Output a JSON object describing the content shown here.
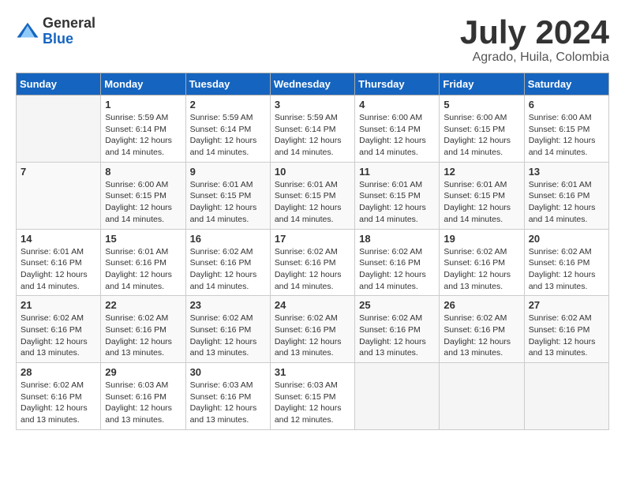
{
  "logo": {
    "general": "General",
    "blue": "Blue"
  },
  "title": "July 2024",
  "location": "Agrado, Huila, Colombia",
  "days_of_week": [
    "Sunday",
    "Monday",
    "Tuesday",
    "Wednesday",
    "Thursday",
    "Friday",
    "Saturday"
  ],
  "weeks": [
    [
      {
        "day": "",
        "info": ""
      },
      {
        "day": "1",
        "info": "Sunrise: 5:59 AM\nSunset: 6:14 PM\nDaylight: 12 hours\nand 14 minutes."
      },
      {
        "day": "2",
        "info": "Sunrise: 5:59 AM\nSunset: 6:14 PM\nDaylight: 12 hours\nand 14 minutes."
      },
      {
        "day": "3",
        "info": "Sunrise: 5:59 AM\nSunset: 6:14 PM\nDaylight: 12 hours\nand 14 minutes."
      },
      {
        "day": "4",
        "info": "Sunrise: 6:00 AM\nSunset: 6:14 PM\nDaylight: 12 hours\nand 14 minutes."
      },
      {
        "day": "5",
        "info": "Sunrise: 6:00 AM\nSunset: 6:15 PM\nDaylight: 12 hours\nand 14 minutes."
      },
      {
        "day": "6",
        "info": "Sunrise: 6:00 AM\nSunset: 6:15 PM\nDaylight: 12 hours\nand 14 minutes."
      }
    ],
    [
      {
        "day": "7",
        "info": ""
      },
      {
        "day": "8",
        "info": "Sunrise: 6:00 AM\nSunset: 6:15 PM\nDaylight: 12 hours\nand 14 minutes."
      },
      {
        "day": "9",
        "info": "Sunrise: 6:01 AM\nSunset: 6:15 PM\nDaylight: 12 hours\nand 14 minutes."
      },
      {
        "day": "10",
        "info": "Sunrise: 6:01 AM\nSunset: 6:15 PM\nDaylight: 12 hours\nand 14 minutes."
      },
      {
        "day": "11",
        "info": "Sunrise: 6:01 AM\nSunset: 6:15 PM\nDaylight: 12 hours\nand 14 minutes."
      },
      {
        "day": "12",
        "info": "Sunrise: 6:01 AM\nSunset: 6:15 PM\nDaylight: 12 hours\nand 14 minutes."
      },
      {
        "day": "13",
        "info": "Sunrise: 6:01 AM\nSunset: 6:16 PM\nDaylight: 12 hours\nand 14 minutes."
      }
    ],
    [
      {
        "day": "14",
        "info": "Sunrise: 6:01 AM\nSunset: 6:16 PM\nDaylight: 12 hours\nand 14 minutes."
      },
      {
        "day": "15",
        "info": "Sunrise: 6:01 AM\nSunset: 6:16 PM\nDaylight: 12 hours\nand 14 minutes."
      },
      {
        "day": "16",
        "info": "Sunrise: 6:02 AM\nSunset: 6:16 PM\nDaylight: 12 hours\nand 14 minutes."
      },
      {
        "day": "17",
        "info": "Sunrise: 6:02 AM\nSunset: 6:16 PM\nDaylight: 12 hours\nand 14 minutes."
      },
      {
        "day": "18",
        "info": "Sunrise: 6:02 AM\nSunset: 6:16 PM\nDaylight: 12 hours\nand 14 minutes."
      },
      {
        "day": "19",
        "info": "Sunrise: 6:02 AM\nSunset: 6:16 PM\nDaylight: 12 hours\nand 13 minutes."
      },
      {
        "day": "20",
        "info": "Sunrise: 6:02 AM\nSunset: 6:16 PM\nDaylight: 12 hours\nand 13 minutes."
      }
    ],
    [
      {
        "day": "21",
        "info": "Sunrise: 6:02 AM\nSunset: 6:16 PM\nDaylight: 12 hours\nand 13 minutes."
      },
      {
        "day": "22",
        "info": "Sunrise: 6:02 AM\nSunset: 6:16 PM\nDaylight: 12 hours\nand 13 minutes."
      },
      {
        "day": "23",
        "info": "Sunrise: 6:02 AM\nSunset: 6:16 PM\nDaylight: 12 hours\nand 13 minutes."
      },
      {
        "day": "24",
        "info": "Sunrise: 6:02 AM\nSunset: 6:16 PM\nDaylight: 12 hours\nand 13 minutes."
      },
      {
        "day": "25",
        "info": "Sunrise: 6:02 AM\nSunset: 6:16 PM\nDaylight: 12 hours\nand 13 minutes."
      },
      {
        "day": "26",
        "info": "Sunrise: 6:02 AM\nSunset: 6:16 PM\nDaylight: 12 hours\nand 13 minutes."
      },
      {
        "day": "27",
        "info": "Sunrise: 6:02 AM\nSunset: 6:16 PM\nDaylight: 12 hours\nand 13 minutes."
      }
    ],
    [
      {
        "day": "28",
        "info": "Sunrise: 6:02 AM\nSunset: 6:16 PM\nDaylight: 12 hours\nand 13 minutes."
      },
      {
        "day": "29",
        "info": "Sunrise: 6:03 AM\nSunset: 6:16 PM\nDaylight: 12 hours\nand 13 minutes."
      },
      {
        "day": "30",
        "info": "Sunrise: 6:03 AM\nSunset: 6:16 PM\nDaylight: 12 hours\nand 13 minutes."
      },
      {
        "day": "31",
        "info": "Sunrise: 6:03 AM\nSunset: 6:15 PM\nDaylight: 12 hours\nand 12 minutes."
      },
      {
        "day": "",
        "info": ""
      },
      {
        "day": "",
        "info": ""
      },
      {
        "day": "",
        "info": ""
      }
    ]
  ]
}
